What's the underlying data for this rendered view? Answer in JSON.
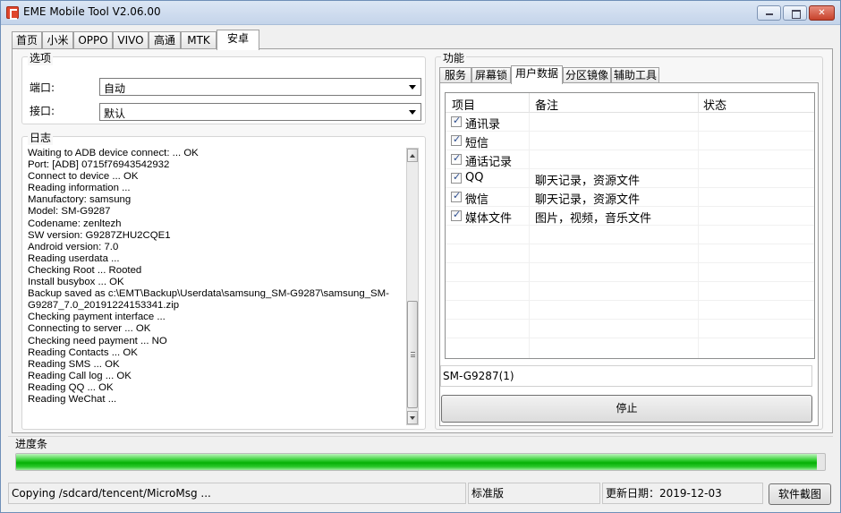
{
  "window": {
    "title": "EME Mobile Tool V2.06.00"
  },
  "main_tabs": [
    {
      "label": "首页"
    },
    {
      "label": "小米"
    },
    {
      "label": "OPPO"
    },
    {
      "label": "VIVO"
    },
    {
      "label": "高通"
    },
    {
      "label": "MTK"
    },
    {
      "label": "安卓"
    }
  ],
  "options": {
    "group_label": "选项",
    "port_label": "端口:",
    "port_value": "自动",
    "interface_label": "接口:",
    "interface_value": "默认"
  },
  "log": {
    "group_label": "日志",
    "lines": "Waiting to ADB device connect: ... OK\nPort: [ADB] 0715f76943542932\nConnect to device ... OK\nReading information ...\nManufactory: samsung\nModel: SM-G9287\nCodename: zenltezh\nSW version: G9287ZHU2CQE1\nAndroid version: 7.0\nReading userdata ...\nChecking Root ... Rooted\nInstall busybox ... OK\nBackup saved as c:\\EMT\\Backup\\Userdata\\samsung_SM-G9287\\samsung_SM-\nG9287_7.0_20191224153341.zip\nChecking payment interface ...\nConnecting to server ... OK\nChecking need payment ... NO\nReading Contacts ... OK\nReading SMS ... OK\nReading Call log ... OK\nReading QQ ... OK\nReading WeChat ..."
  },
  "function": {
    "group_label": "功能",
    "tabs": [
      {
        "label": "服务"
      },
      {
        "label": "屏幕锁"
      },
      {
        "label": "用户数据"
      },
      {
        "label": "分区镜像"
      },
      {
        "label": "辅助工具"
      }
    ],
    "columns": {
      "item": "项目",
      "note": "备注",
      "status": "状态"
    },
    "rows": [
      {
        "name": "通讯录",
        "note": "",
        "checked": true
      },
      {
        "name": "短信",
        "note": "",
        "checked": true
      },
      {
        "name": "通话记录",
        "note": "",
        "checked": true
      },
      {
        "name": "QQ",
        "note": "聊天记录，资源文件",
        "checked": true
      },
      {
        "name": "微信",
        "note": "聊天记录，资源文件",
        "checked": true
      },
      {
        "name": "媒体文件",
        "note": "图片，视频，音乐文件",
        "checked": true
      }
    ],
    "device": "SM-G9287(1)",
    "stop_label": "停止"
  },
  "progress": {
    "label": "进度条",
    "percent": 99,
    "color": "#06b006"
  },
  "statusbar": {
    "message": "Copying /sdcard/tencent/MicroMsg ...",
    "edition": "标准版",
    "update_date": "更新日期：2019-12-03",
    "snapshot_label": "软件截图"
  }
}
